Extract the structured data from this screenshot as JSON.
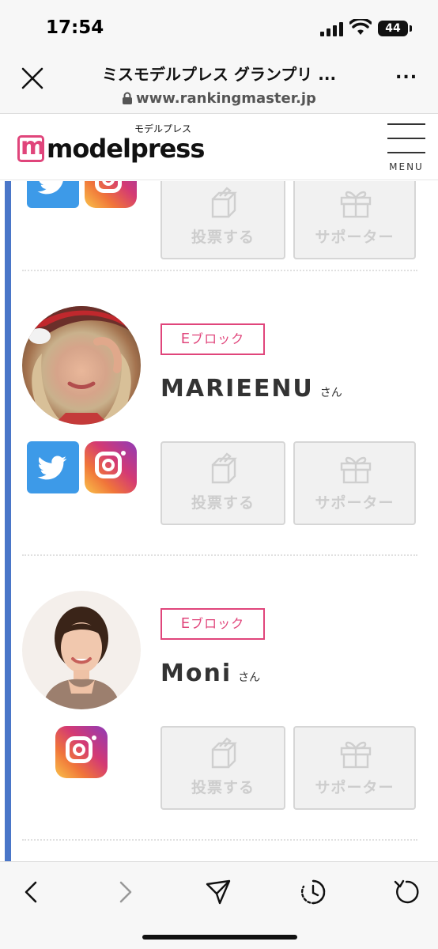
{
  "status": {
    "time": "17:54",
    "battery": "44"
  },
  "browser": {
    "title": "ミスモデルプレス グランプリ ...",
    "url": "www.rankingmaster.jp",
    "more": "..."
  },
  "site": {
    "logo_text": "modelpress",
    "logo_sub": "モデルプレス",
    "menu_label": "MENU"
  },
  "actions": {
    "vote_label": "投票する",
    "supporter_label": "サポーター"
  },
  "entries": [
    {
      "block_letter": "E",
      "block_suffix": "ブロック",
      "name": "MARIEENU",
      "honorific": "さん"
    },
    {
      "block_letter": "E",
      "block_suffix": "ブロック",
      "name": "Moni",
      "honorific": "さん"
    }
  ],
  "colors": {
    "accent": "#e0457b",
    "rail": "#4a76c8",
    "twitter": "#3d9ae8"
  }
}
